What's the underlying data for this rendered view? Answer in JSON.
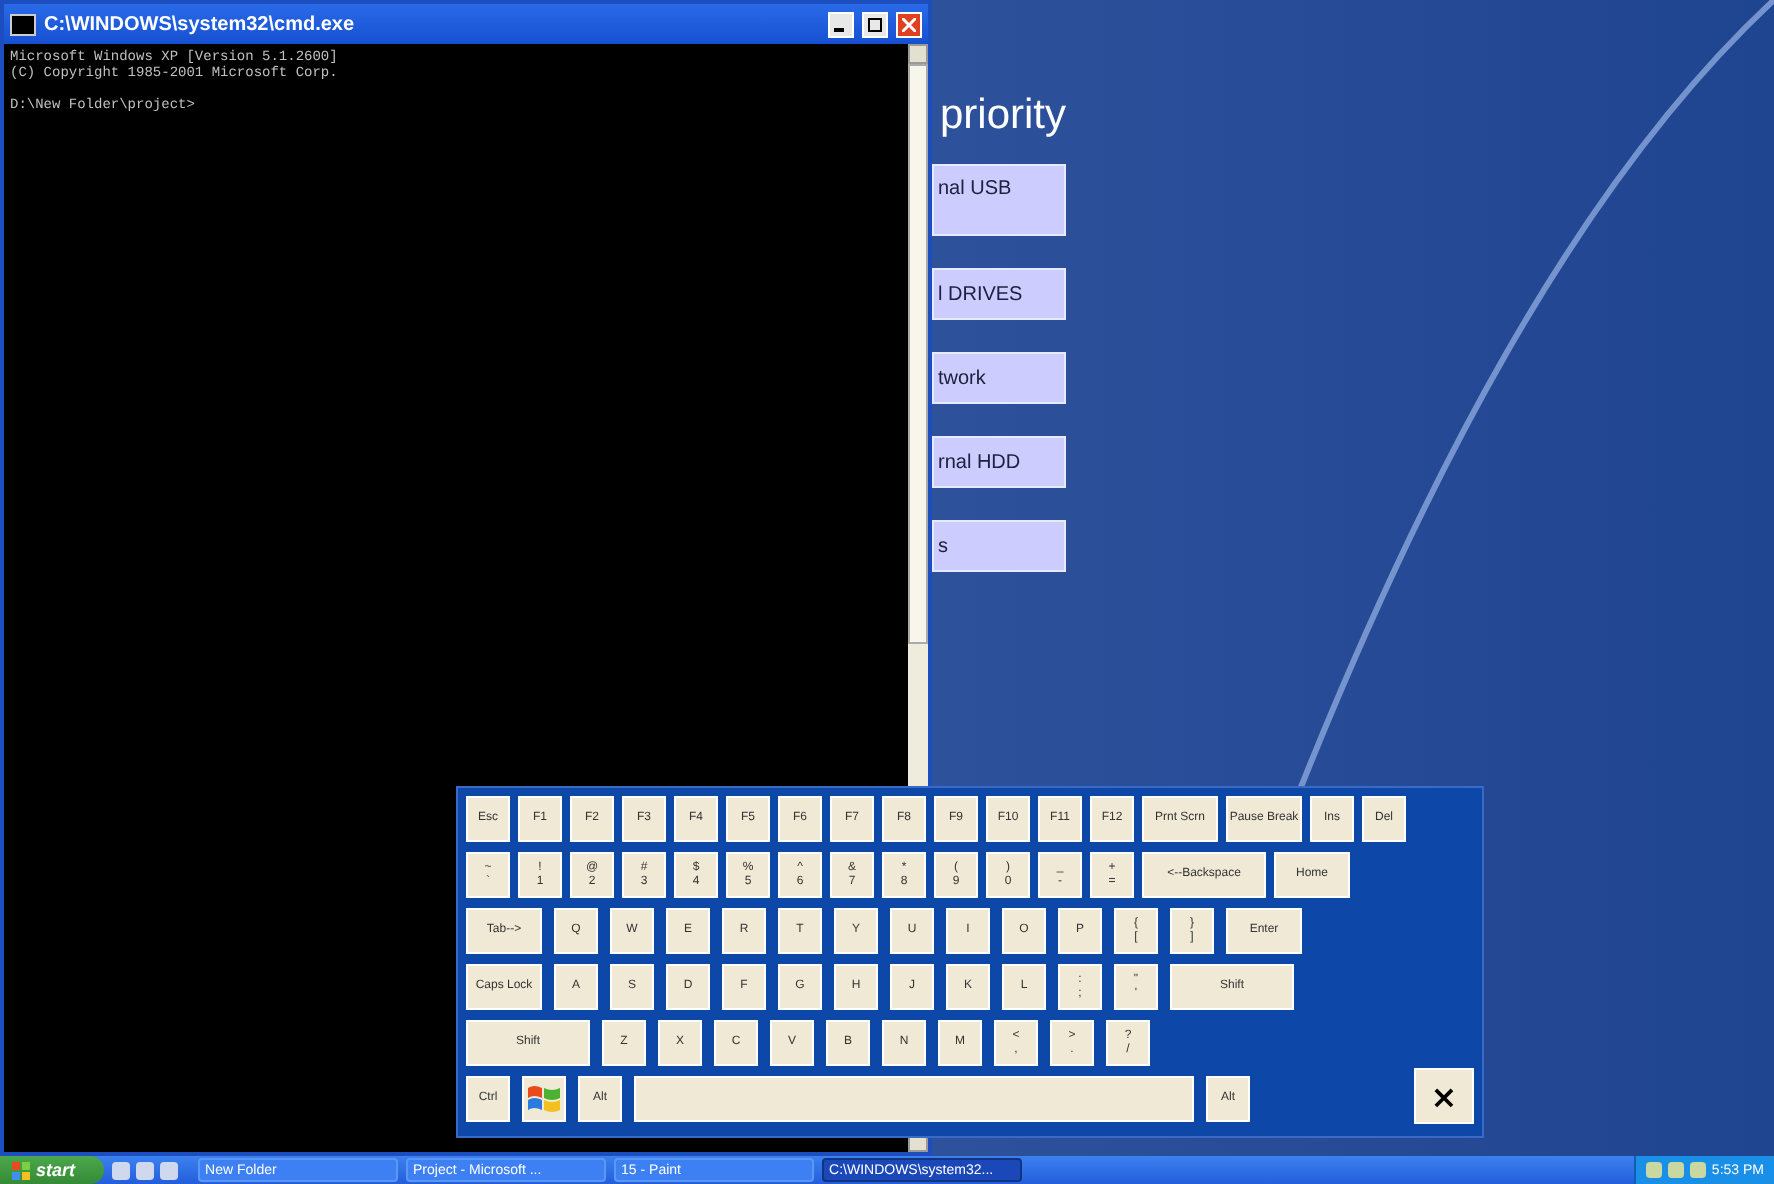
{
  "cmd_window": {
    "title": "C:\\WINDOWS\\system32\\cmd.exe",
    "lines": [
      "Microsoft Windows XP [Version 5.1.2600]",
      "(C) Copyright 1985-2001 Microsoft Corp."
    ],
    "prompt": "D:\\New Folder\\project>"
  },
  "background_app": {
    "heading": "priority",
    "buttons": [
      "nal USB",
      "l DRIVES",
      "twork",
      "rnal HDD",
      "s"
    ]
  },
  "keyboard": {
    "rows": [
      {
        "keys": [
          {
            "kind": "key",
            "label": "Esc"
          },
          {
            "kind": "key",
            "label": "F1"
          },
          {
            "kind": "key",
            "label": "F2"
          },
          {
            "kind": "key",
            "label": "F3"
          },
          {
            "kind": "key",
            "label": "F4"
          },
          {
            "kind": "key",
            "label": "F5"
          },
          {
            "kind": "key",
            "label": "F6"
          },
          {
            "kind": "key",
            "label": "F7"
          },
          {
            "kind": "key",
            "label": "F8"
          },
          {
            "kind": "key",
            "label": "F9"
          },
          {
            "kind": "key",
            "label": "F10"
          },
          {
            "kind": "key",
            "label": "F11"
          },
          {
            "kind": "key",
            "label": "F12"
          },
          {
            "kind": "wide",
            "label": "Prnt Scrn"
          },
          {
            "kind": "wide",
            "label": "Pause Break"
          },
          {
            "kind": "key",
            "label": "Ins"
          },
          {
            "kind": "key",
            "label": "Del"
          }
        ]
      },
      {
        "keys": [
          {
            "kind": "dual",
            "upper": "~",
            "lower": "`"
          },
          {
            "kind": "dual",
            "upper": "!",
            "lower": "1"
          },
          {
            "kind": "dual",
            "upper": "@",
            "lower": "2"
          },
          {
            "kind": "dual",
            "upper": "#",
            "lower": "3"
          },
          {
            "kind": "dual",
            "upper": "$",
            "lower": "4"
          },
          {
            "kind": "dual",
            "upper": "%",
            "lower": "5"
          },
          {
            "kind": "dual",
            "upper": "^",
            "lower": "6"
          },
          {
            "kind": "dual",
            "upper": "&",
            "lower": "7"
          },
          {
            "kind": "dual",
            "upper": "*",
            "lower": "8"
          },
          {
            "kind": "dual",
            "upper": "(",
            "lower": "9"
          },
          {
            "kind": "dual",
            "upper": ")",
            "lower": "0"
          },
          {
            "kind": "dual",
            "upper": "_",
            "lower": "-"
          },
          {
            "kind": "dual",
            "upper": "+",
            "lower": "="
          },
          {
            "kind": "xwide",
            "label": "<--Backspace"
          },
          {
            "kind": "wide",
            "label": "Home"
          }
        ]
      },
      {
        "keys": [
          {
            "kind": "wide",
            "label": "Tab-->"
          },
          {
            "kind": "key",
            "label": "Q"
          },
          {
            "kind": "key",
            "label": "W"
          },
          {
            "kind": "key",
            "label": "E"
          },
          {
            "kind": "key",
            "label": "R"
          },
          {
            "kind": "key",
            "label": "T"
          },
          {
            "kind": "key",
            "label": "Y"
          },
          {
            "kind": "key",
            "label": "U"
          },
          {
            "kind": "key",
            "label": "I"
          },
          {
            "kind": "key",
            "label": "O"
          },
          {
            "kind": "key",
            "label": "P"
          },
          {
            "kind": "dual",
            "upper": "{",
            "lower": "["
          },
          {
            "kind": "dual",
            "upper": "}",
            "lower": "]"
          },
          {
            "kind": "wide",
            "label": "Enter"
          }
        ]
      },
      {
        "keys": [
          {
            "kind": "wide",
            "label": "Caps Lock"
          },
          {
            "kind": "key",
            "label": "A"
          },
          {
            "kind": "key",
            "label": "S"
          },
          {
            "kind": "key",
            "label": "D"
          },
          {
            "kind": "key",
            "label": "F"
          },
          {
            "kind": "key",
            "label": "G"
          },
          {
            "kind": "key",
            "label": "H"
          },
          {
            "kind": "key",
            "label": "J"
          },
          {
            "kind": "key",
            "label": "K"
          },
          {
            "kind": "key",
            "label": "L"
          },
          {
            "kind": "dual",
            "upper": ":",
            "lower": ";"
          },
          {
            "kind": "dual",
            "upper": "\"",
            "lower": "'"
          },
          {
            "kind": "xwide",
            "label": "Shift"
          }
        ]
      },
      {
        "keys": [
          {
            "kind": "xwide",
            "label": "Shift"
          },
          {
            "kind": "key",
            "label": "Z"
          },
          {
            "kind": "key",
            "label": "X"
          },
          {
            "kind": "key",
            "label": "C"
          },
          {
            "kind": "key",
            "label": "V"
          },
          {
            "kind": "key",
            "label": "B"
          },
          {
            "kind": "key",
            "label": "N"
          },
          {
            "kind": "key",
            "label": "M"
          },
          {
            "kind": "dual",
            "upper": "<",
            "lower": ","
          },
          {
            "kind": "dual",
            "upper": ">",
            "lower": "."
          },
          {
            "kind": "dual",
            "upper": "?",
            "lower": "/"
          }
        ]
      },
      {
        "keys": [
          {
            "kind": "key",
            "label": "Ctrl"
          },
          {
            "kind": "logo"
          },
          {
            "kind": "key",
            "label": "Alt"
          },
          {
            "kind": "space"
          },
          {
            "kind": "key",
            "label": "Alt"
          }
        ]
      }
    ],
    "close": "×"
  },
  "taskbar": {
    "start": "start",
    "tasks": [
      {
        "label": "New Folder",
        "selected": false
      },
      {
        "label": "Project - Microsoft ...",
        "selected": false
      },
      {
        "label": "15 - Paint",
        "selected": false
      },
      {
        "label": "C:\\WINDOWS\\system32...",
        "selected": true
      }
    ],
    "clock": "5:53 PM"
  }
}
